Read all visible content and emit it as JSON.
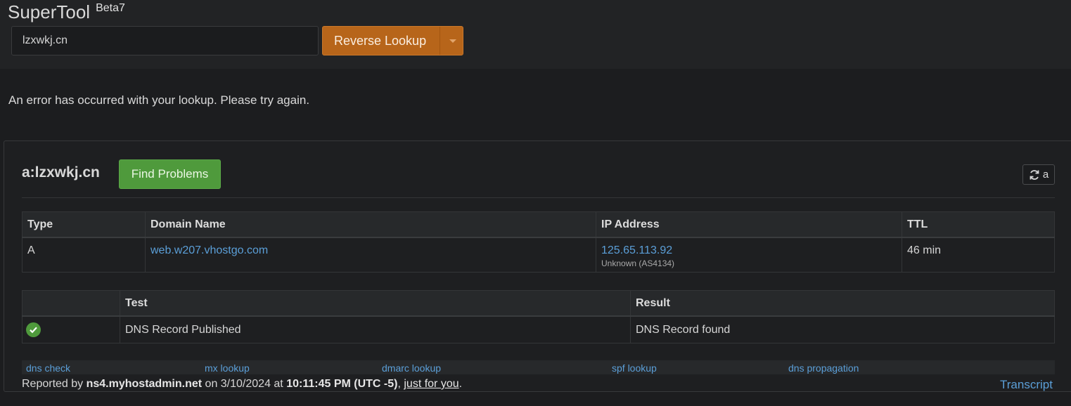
{
  "brand": {
    "name": "SuperTool",
    "version": "Beta7"
  },
  "search": {
    "value": "lzxwkj.cn",
    "button_label": "Reverse Lookup"
  },
  "error_message": "An error has occurred with your lookup. Please try again.",
  "result": {
    "title": "a:lzxwkj.cn",
    "find_problems_label": "Find Problems",
    "refresh_label": "a",
    "records_table": {
      "headers": [
        "Type",
        "Domain Name",
        "IP Address",
        "TTL"
      ],
      "rows": [
        {
          "type": "A",
          "domain": "web.w207.vhostgo.com",
          "ip": "125.65.113.92",
          "ip_note": "Unknown (AS4134)",
          "ttl": "46 min"
        }
      ]
    },
    "tests_table": {
      "headers": [
        "",
        "Test",
        "Result"
      ],
      "rows": [
        {
          "status": "pass",
          "test": "DNS Record Published",
          "result": "DNS Record found"
        }
      ]
    },
    "quick_links": [
      "dns check",
      "mx lookup",
      "dmarc lookup",
      "spf lookup",
      "dns propagation"
    ],
    "footer": {
      "prefix": "Reported by ",
      "server": "ns4.myhostadmin.net",
      "on": " on 3/10/2024 at ",
      "time": "10:11:45 PM (UTC -5)",
      "comma": ", ",
      "just_for_you": "just for you",
      "period": "."
    },
    "transcript_label": "Transcript"
  },
  "colors": {
    "accent_orange": "#b7651a",
    "accent_green": "#4f9a3c",
    "link_blue": "#5b9fd8"
  },
  "icons": {
    "refresh": "refresh-icon",
    "check": "check-circle-icon",
    "caret": "caret-down-icon"
  }
}
